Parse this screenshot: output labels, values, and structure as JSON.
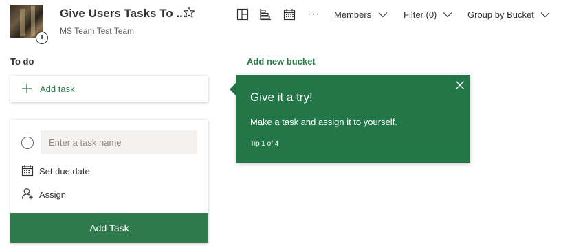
{
  "header": {
    "plan_title": "Give Users Tasks To ...",
    "group_name": "MS Team Test Team",
    "info_badge": "i",
    "more_glyph": "···",
    "members_label": "Members",
    "filter_label": "Filter (0)",
    "group_by_label": "Group by Bucket",
    "icons": [
      "star-icon",
      "board-view-icon",
      "chart-view-icon",
      "schedule-view-icon",
      "more-icon",
      "chevron-down-icon"
    ]
  },
  "board": {
    "bucket_name": "To do",
    "add_bucket_label": "Add new bucket",
    "add_task_label": "Add task",
    "new_task": {
      "name_placeholder": "Enter a task name",
      "due_date_label": "Set due date",
      "assign_label": "Assign",
      "submit_label": "Add Task"
    }
  },
  "callout": {
    "title": "Give it a try!",
    "body": "Make a task and assign it to yourself.",
    "tip": "Tip 1 of 4"
  },
  "colors": {
    "accent": "#2f7a4c",
    "callout_bg": "#237648",
    "text": "#323130",
    "muted_text": "#605e5c",
    "input_bg": "#f3f2f1"
  }
}
